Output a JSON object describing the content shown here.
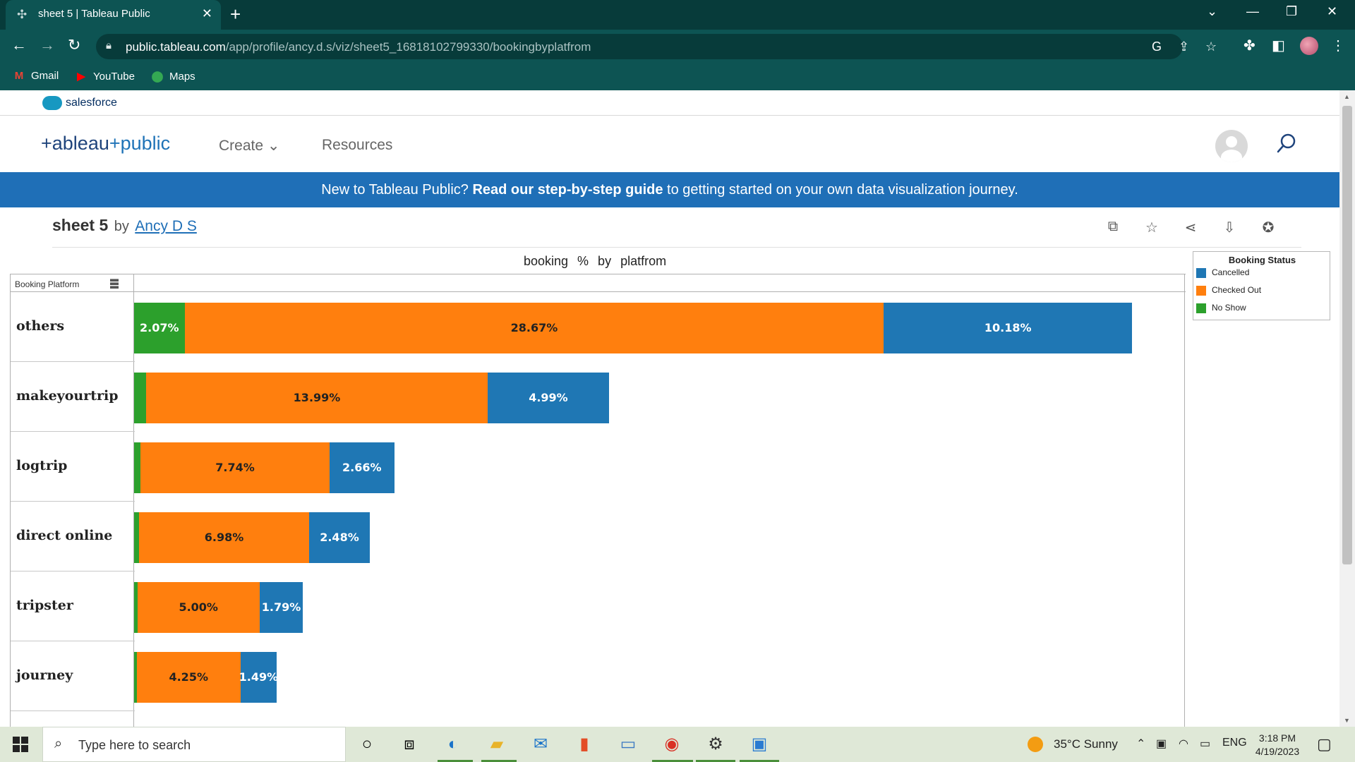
{
  "browser": {
    "tab_title": "sheet 5 | Tableau Public",
    "tab_close": "✕",
    "new_tab": "+",
    "url_host": "public.tableau.com",
    "url_path": "/app/profile/ancy.d.s/viz/sheet5_16818102799330/bookingbyplatfrom",
    "bookmarks": [
      {
        "label": "Gmail",
        "icon": "M"
      },
      {
        "label": "YouTube",
        "icon": "▶"
      },
      {
        "label": "Maps",
        "icon": "⬤"
      }
    ]
  },
  "salesforce": {
    "label": "salesforce"
  },
  "header": {
    "logo_part1": "+ableau",
    "logo_part2": "+public",
    "nav": [
      {
        "label": "Create ⌄"
      },
      {
        "label": "Resources"
      }
    ]
  },
  "banner": {
    "prefix": "New to Tableau Public? ",
    "bold": "Read our step-by-step guide",
    "suffix": " to getting started on your own data visualization journey."
  },
  "viz": {
    "title": "sheet 5",
    "by": "by",
    "author": "Ancy D S",
    "sheet_heading": "booking % by platfrom",
    "row_header": "Booking Platform",
    "legend_title": "Booking Status"
  },
  "chart_data": {
    "type": "bar",
    "orientation": "horizontal-stacked",
    "title": "booking % by platfrom",
    "xlabel": "",
    "ylabel": "Booking Platform",
    "categories": [
      "others",
      "makeyourtrip",
      "logtrip",
      "direct online",
      "tripster",
      "journey"
    ],
    "series": [
      {
        "name": "No Show",
        "color": "#2ca02c",
        "values": [
          2.07,
          0.5,
          0.27,
          0.2,
          0.14,
          0.11
        ],
        "labels": [
          "2.07%",
          "",
          "",
          "",
          "",
          ""
        ]
      },
      {
        "name": "Checked Out",
        "color": "#ff7f0e",
        "values": [
          28.67,
          13.99,
          7.74,
          6.98,
          5.0,
          4.25
        ],
        "labels": [
          "28.67%",
          "13.99%",
          "7.74%",
          "6.98%",
          "5.00%",
          "4.25%"
        ]
      },
      {
        "name": "Cancelled",
        "color": "#1f77b4",
        "values": [
          10.18,
          4.99,
          2.66,
          2.48,
          1.79,
          1.49
        ],
        "labels": [
          "10.18%",
          "4.99%",
          "2.66%",
          "2.48%",
          "1.79%",
          "1.49%"
        ]
      }
    ],
    "legend": {
      "placement": "top-right",
      "order": [
        "Cancelled",
        "Checked Out",
        "No Show"
      ]
    },
    "x_range_max_percent": 43
  },
  "taskbar": {
    "search_placeholder": "Type here to search",
    "weather": "35°C  Sunny",
    "lang": "ENG",
    "time": "3:18 PM",
    "date": "4/19/2023"
  }
}
